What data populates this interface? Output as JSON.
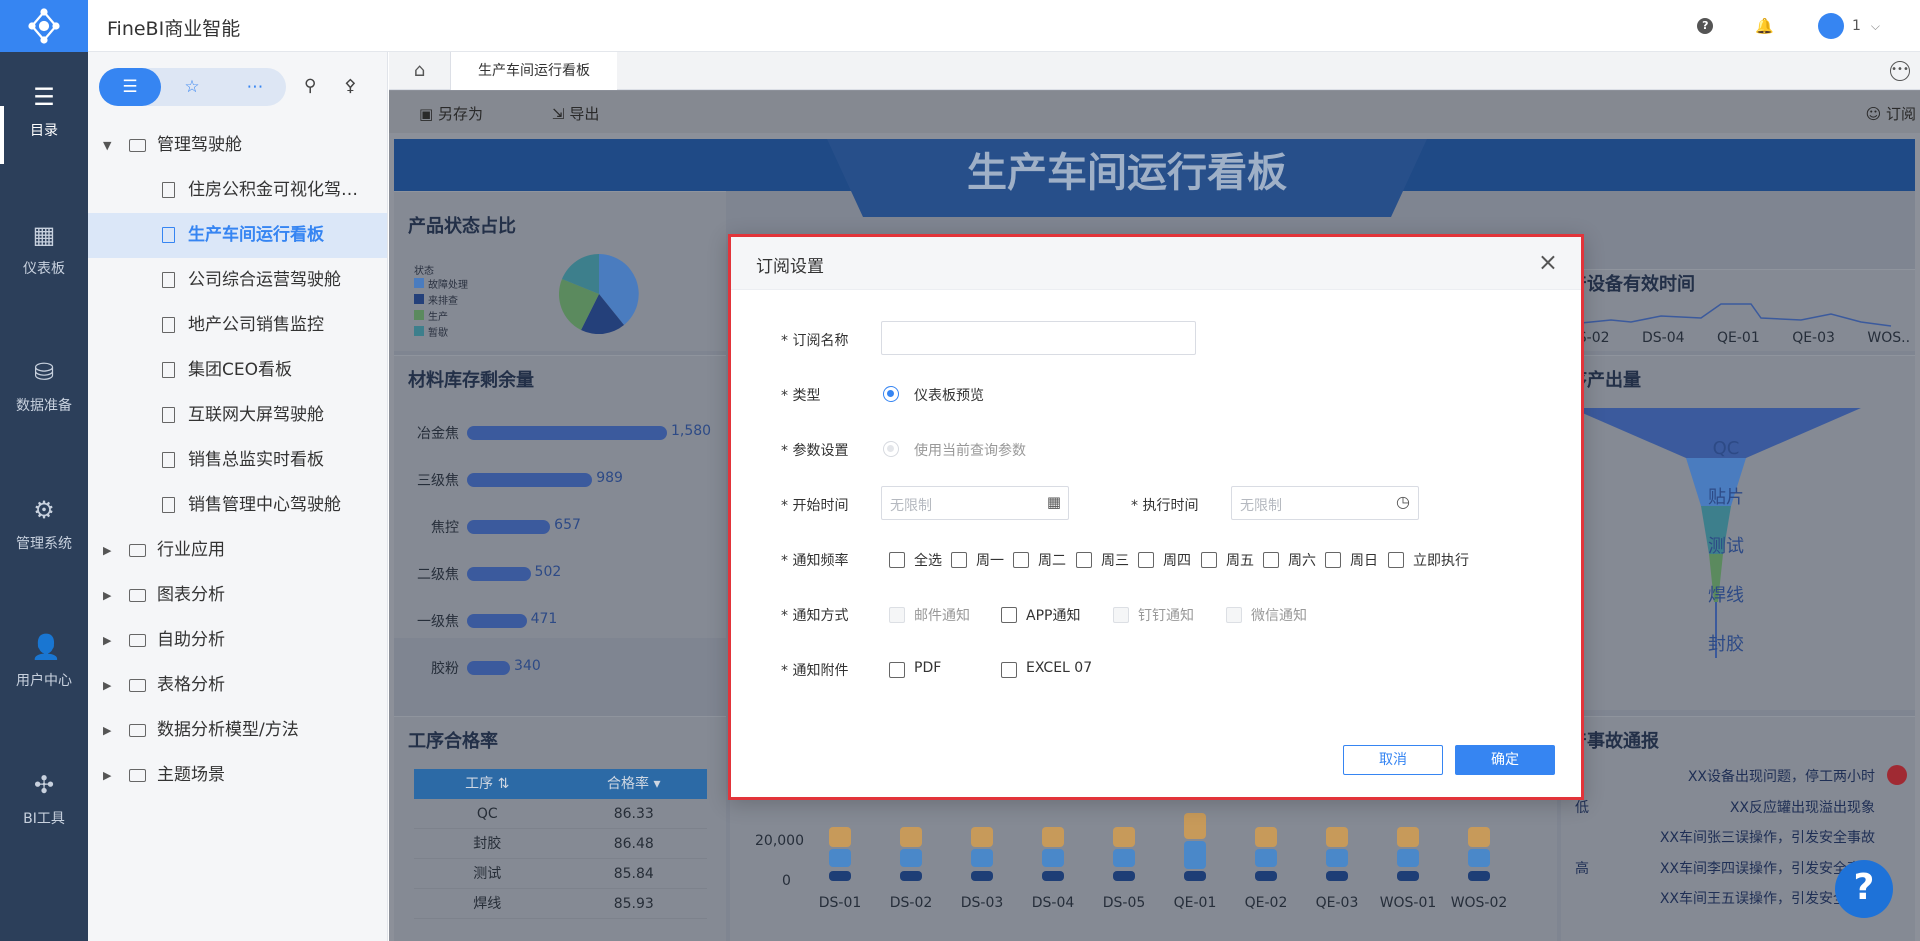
{
  "app": {
    "title": "FineBI商业智能",
    "user_name": "1",
    "help_glyph": "?"
  },
  "leftnav": [
    {
      "label": "目录",
      "icon": "list-icon",
      "glyph": "☰"
    },
    {
      "label": "仪表板",
      "icon": "dashboard-icon",
      "glyph": "▦"
    },
    {
      "label": "数据准备",
      "icon": "database-icon",
      "glyph": "⛁"
    },
    {
      "label": "管理系统",
      "icon": "gear-icon",
      "glyph": "⚙"
    },
    {
      "label": "用户中心",
      "icon": "user-icon",
      "glyph": "👤"
    },
    {
      "label": "BI工具",
      "icon": "tools-icon",
      "glyph": "✣"
    }
  ],
  "tree": {
    "root": "管理驾驶舱",
    "children": [
      "住房公积金可视化驾驶舱",
      "生产车间运行看板",
      "公司综合运营驾驶舱",
      "地产公司销售监控",
      "集团CEO看板",
      "互联网大屏驾驶舱",
      "销售总监实时看板",
      "销售管理中心驾驶舱"
    ],
    "folders": [
      "行业应用",
      "图表分析",
      "自助分析",
      "表格分析",
      "数据分析模型/方法",
      "主题场景"
    ]
  },
  "tabs": {
    "active": "生产车间运行看板"
  },
  "toolbar": {
    "save_as": "另存为",
    "export": "导出",
    "subscribe": "订阅"
  },
  "dashboard": {
    "title": "生产车间运行看板",
    "panel_product_status": "产品状态占比",
    "panel_material": "材料库存剩余量",
    "panel_pass_rate": "工序合格率",
    "panel_right_top": "产设备有效时间",
    "panel_right_mid": "序产出量",
    "panel_right_bottom": "产事故通报",
    "pie_legend_title": "状态",
    "pie_legend": [
      "故障处理",
      "来排查",
      "生产",
      "暂歇"
    ],
    "line_axis": [
      "DS-02",
      "DS-04",
      "QE-01",
      "QE-03",
      "WOS.."
    ],
    "funnel": [
      "QC",
      "贴片",
      "测试",
      "焊线",
      "封胶"
    ],
    "bottom_axis": [
      "DS-01",
      "DS-02",
      "DS-03",
      "DS-04",
      "DS-05",
      "QE-01",
      "QE-02",
      "QE-03",
      "WOS-01",
      "WOS-02"
    ],
    "bottom_y": [
      "20,000",
      "0"
    ],
    "incidents": [
      {
        "level": "",
        "text": "XX设备出现问题，停工两小时"
      },
      {
        "level": "低",
        "text": "XX反应罐出现溢出现象"
      },
      {
        "level": "",
        "text": "XX车间张三误操作，引发安全事故"
      },
      {
        "level": "高",
        "text": "XX车间李四误操作，引发安全事故"
      },
      {
        "level": "",
        "text": "XX车间王五误操作，引发安全事故"
      }
    ],
    "table_headers": [
      "工序",
      "合格率"
    ],
    "table_rows": [
      [
        "QC",
        "86.33"
      ],
      [
        "封胶",
        "86.48"
      ],
      [
        "测试",
        "85.84"
      ],
      [
        "焊线",
        "85.93"
      ]
    ]
  },
  "chart_data": {
    "type": "bar",
    "title": "材料库存剩余量",
    "categories": [
      "冶金焦",
      "三级焦",
      "焦控",
      "二级焦",
      "一级焦",
      "胶粉"
    ],
    "values": [
      1580,
      989,
      657,
      502,
      471,
      340
    ],
    "value_labels": [
      "1,580",
      "989",
      "657",
      "502",
      "471",
      "340"
    ],
    "orientation": "horizontal"
  },
  "modal": {
    "title": "订阅设置",
    "name_label": "* 订阅名称",
    "name_value": "",
    "type_label": "* 类型",
    "type_option": "仪表板预览",
    "param_label": "* 参数设置",
    "param_option": "使用当前查询参数",
    "start_label": "* 开始时间",
    "start_placeholder": "无限制",
    "exec_label": "* 执行时间",
    "exec_placeholder": "无限制",
    "freq_label": "* 通知频率",
    "freq_options": [
      "全选",
      "周一",
      "周二",
      "周三",
      "周四",
      "周五",
      "周六",
      "周日",
      "立即执行"
    ],
    "method_label": "* 通知方式",
    "method_options": [
      "邮件通知",
      "APP通知",
      "钉钉通知",
      "微信通知"
    ],
    "attach_label": "* 通知附件",
    "attach_options": [
      "PDF",
      "EXCEL 07"
    ],
    "cancel": "取消",
    "confirm": "确定"
  }
}
